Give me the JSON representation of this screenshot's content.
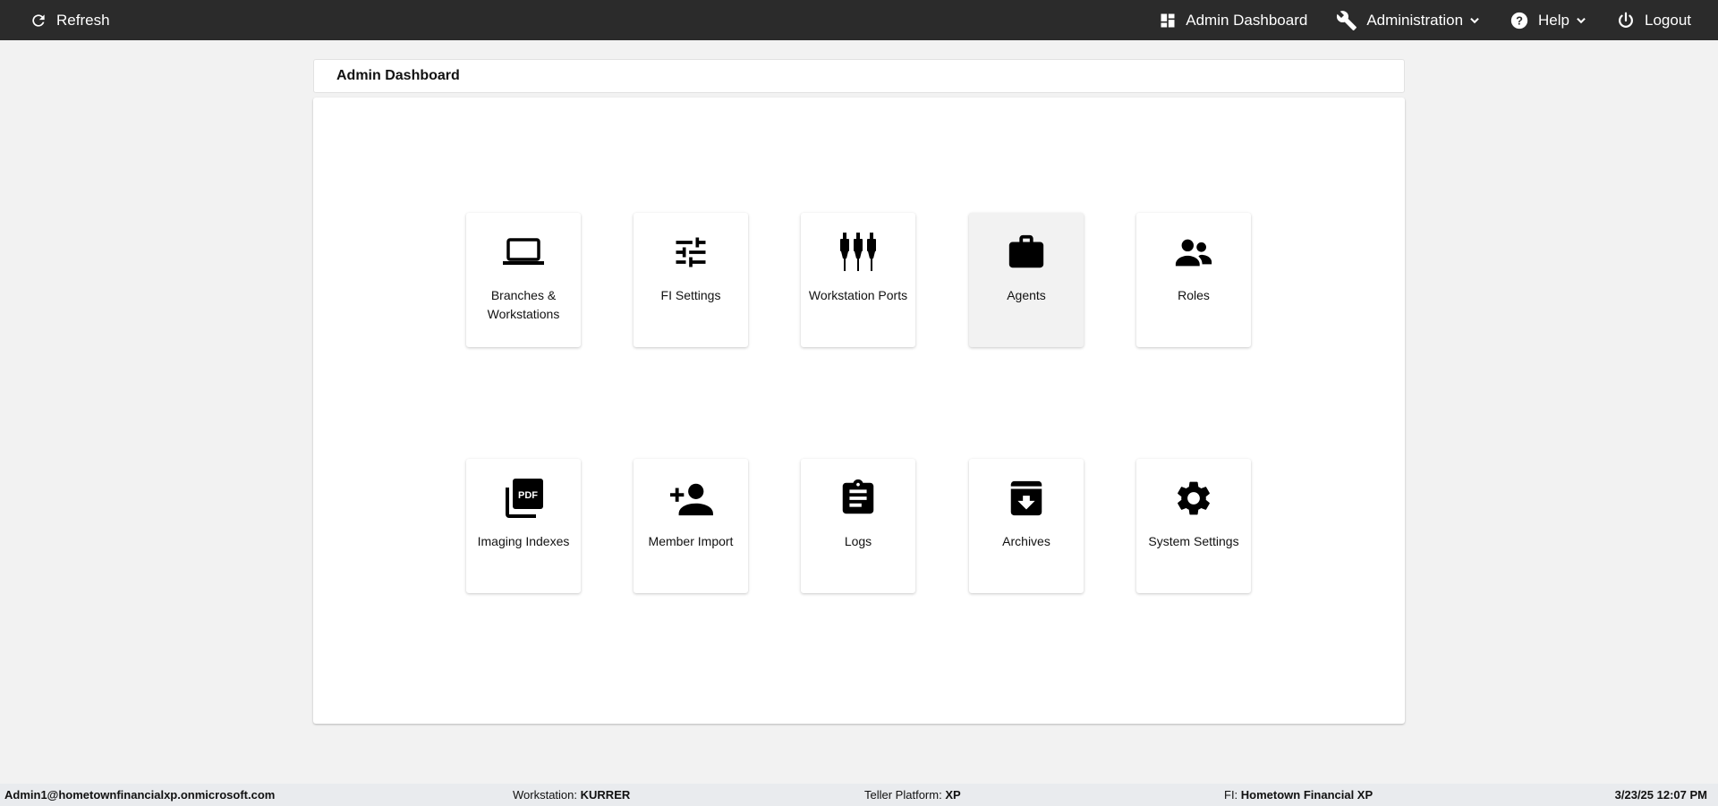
{
  "topbar": {
    "refresh_label": "Refresh",
    "admin_dashboard_label": "Admin Dashboard",
    "administration_label": "Administration",
    "help_label": "Help",
    "logout_label": "Logout"
  },
  "header": {
    "title": "Admin Dashboard"
  },
  "tiles": [
    {
      "label": "Branches & Workstations",
      "icon": "laptop-icon"
    },
    {
      "label": "FI Settings",
      "icon": "tune-icon"
    },
    {
      "label": "Workstation Ports",
      "icon": "ports-icon"
    },
    {
      "label": "Agents",
      "icon": "briefcase-icon"
    },
    {
      "label": "Roles",
      "icon": "people-icon"
    },
    {
      "label": "Imaging Indexes",
      "icon": "pdf-icon"
    },
    {
      "label": "Member Import",
      "icon": "person-add-icon"
    },
    {
      "label": "Logs",
      "icon": "clipboard-icon"
    },
    {
      "label": "Archives",
      "icon": "archive-icon"
    },
    {
      "label": "System Settings",
      "icon": "gear-icon"
    }
  ],
  "footer": {
    "user": "Admin1@hometownfinancialxp.onmicrosoft.com",
    "workstation_label": "Workstation:",
    "workstation_value": "KURRER",
    "platform_label": "Teller Platform:",
    "platform_value": "XP",
    "fi_label": "FI:",
    "fi_value": "Hometown Financial XP",
    "datetime": "3/23/25 12:07 PM"
  }
}
